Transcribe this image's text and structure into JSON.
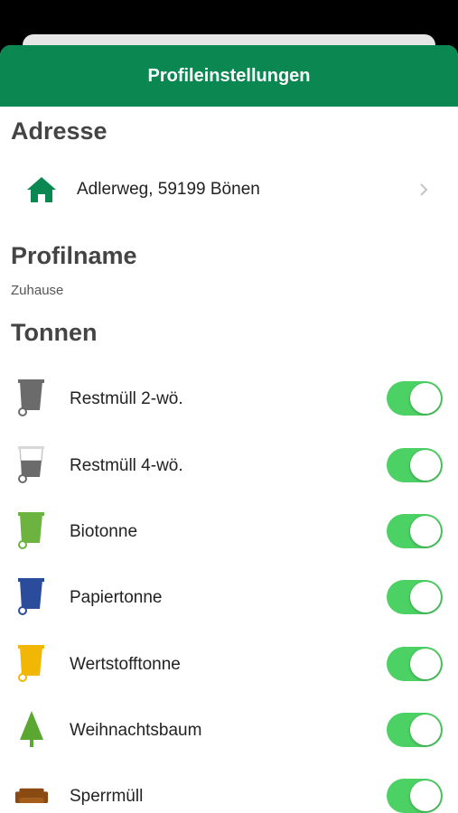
{
  "header": {
    "title": "Profileinstellungen"
  },
  "address_section": {
    "title": "Adresse",
    "address": "Adlerweg, 59199 Bönen",
    "icon": "home-icon",
    "chevron": "chevron-right-icon"
  },
  "profile_section": {
    "title": "Profilname",
    "value": "Zuhause"
  },
  "bins_section": {
    "title": "Tonnen",
    "items": [
      {
        "label": "Restmüll 2-wö.",
        "icon": "grey-bin-icon",
        "color": "#6b6b6b",
        "enabled": true
      },
      {
        "label": "Restmüll 4-wö.",
        "icon": "grey-bin-half-icon",
        "color": "#6b6b6b",
        "enabled": true
      },
      {
        "label": "Biotonne",
        "icon": "green-bin-icon",
        "color": "#6cb33f",
        "enabled": true
      },
      {
        "label": "Papiertonne",
        "icon": "blue-bin-icon",
        "color": "#2b4c9b",
        "enabled": true
      },
      {
        "label": "Wertstofftonne",
        "icon": "yellow-bin-icon",
        "color": "#f2b705",
        "enabled": true
      },
      {
        "label": "Weihnachtsbaum",
        "icon": "tree-icon",
        "color": "#5aa832",
        "enabled": true
      },
      {
        "label": "Sperrmüll",
        "icon": "sofa-icon",
        "color": "#8a4b13",
        "enabled": true
      }
    ]
  },
  "colors": {
    "brand": "#0b8752",
    "toggle_on": "#4cd264"
  }
}
